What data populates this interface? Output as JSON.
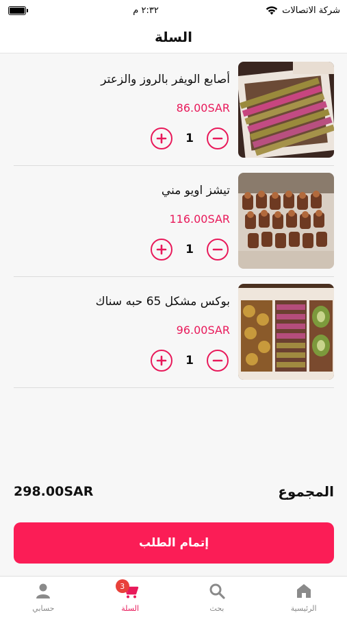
{
  "status_bar": {
    "carrier": "شركة الاتصالات",
    "time": "٢:٣٢ م",
    "battery_level": 1.0
  },
  "header": {
    "title": "السلة"
  },
  "cart": {
    "items": [
      {
        "name": "أصابع الويفر بالروز والزعتر",
        "price": "86.00SAR",
        "quantity": "1",
        "image": "wafer-fingers-box"
      },
      {
        "name": "تيشز اويو مني",
        "price": "116.00SAR",
        "quantity": "1",
        "image": "chocolate-box"
      },
      {
        "name": "بوكس مشكل 65 حبه سناك",
        "price": "96.00SAR",
        "quantity": "1",
        "image": "mixed-snack-box"
      }
    ]
  },
  "total": {
    "label": "المجموع",
    "amount": "298.00SAR"
  },
  "checkout": {
    "label": "إتمام الطلب"
  },
  "bottom_nav": {
    "items": [
      {
        "label": "الرئيسية",
        "icon": "home-icon"
      },
      {
        "label": "بحث",
        "icon": "search-icon"
      },
      {
        "label": "السلة",
        "icon": "cart-icon",
        "badge": "3",
        "active": true
      },
      {
        "label": "حسابي",
        "icon": "user-icon"
      }
    ]
  },
  "colors": {
    "accent": "#e8195a",
    "button": "#fb1d56",
    "badge": "#e8413a"
  }
}
